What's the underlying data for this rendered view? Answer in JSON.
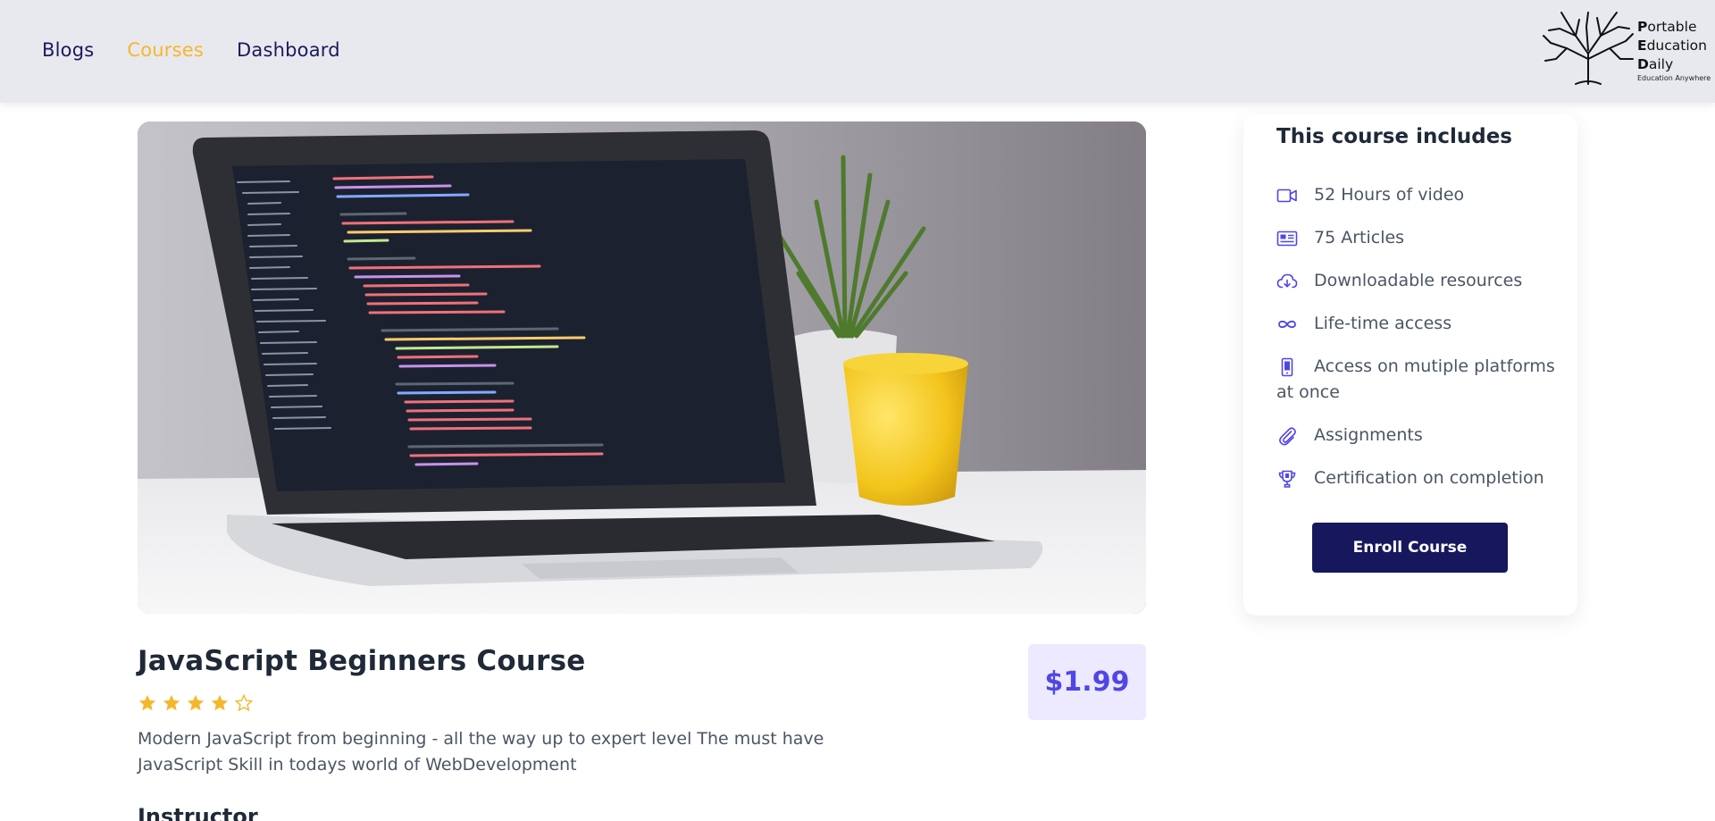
{
  "nav": {
    "items": [
      {
        "label": "Blogs",
        "active": false
      },
      {
        "label": "Courses",
        "active": true
      },
      {
        "label": "Dashboard",
        "active": false
      }
    ]
  },
  "logo": {
    "line1_initial": "P",
    "line1_rest": "ortable",
    "line2_initial": "E",
    "line2_rest": "ducation",
    "line3_initial": "D",
    "line3_rest": "aily",
    "tagline": "Education Anywhere"
  },
  "course": {
    "title": "JavaScript Beginners Course",
    "rating": 4,
    "rating_max": 5,
    "description": "Modern JavaScript from beginning - all the way up to expert level The must have JavaScript Skill in todays world of WebDevelopment",
    "price": "$1.99",
    "instructor_heading": "Instructor"
  },
  "sidebar": {
    "title": "This course includes",
    "features": [
      {
        "icon": "video-icon",
        "label": "52 Hours of video"
      },
      {
        "icon": "article-icon",
        "label": "75 Articles"
      },
      {
        "icon": "cloud-download-icon",
        "label": "Downloadable resources"
      },
      {
        "icon": "infinity-icon",
        "label": "Life-time access"
      },
      {
        "icon": "mobile-icon",
        "label": "Access on mutiple platforms at once"
      },
      {
        "icon": "paperclip-icon",
        "label": "Assignments"
      },
      {
        "icon": "trophy-icon",
        "label": "Certification on completion"
      }
    ],
    "enroll_label": "Enroll Course"
  },
  "colors": {
    "header_bg": "#e8e9ee",
    "nav_text": "#1a1a5c",
    "nav_active": "#f5b72a",
    "star": "#f5b72a",
    "price_bg": "#ede9fe",
    "price_text": "#4f46e5",
    "icon": "#4f46e5",
    "button_bg": "#17175e"
  }
}
